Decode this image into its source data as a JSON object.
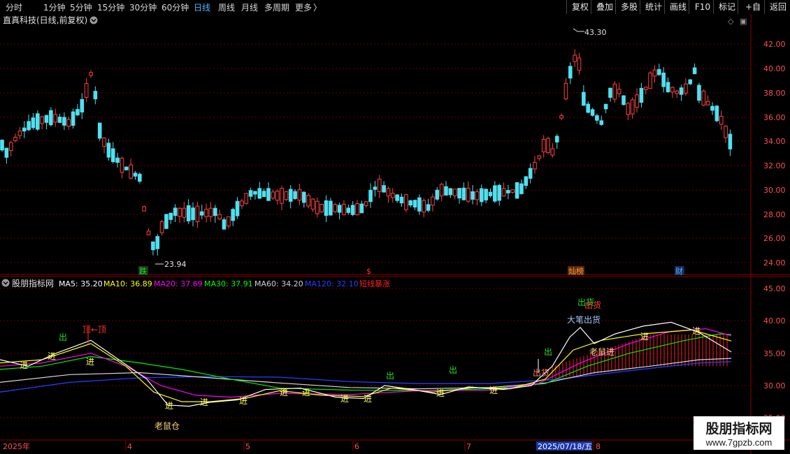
{
  "toolbar": {
    "periods": [
      "分时",
      "1分钟",
      "5分钟",
      "15分钟",
      "30分钟",
      "60分钟",
      "日线",
      "周线",
      "月线",
      "多周期",
      "更多"
    ],
    "active_period": "日线",
    "more_arrow": "〉",
    "right_buttons": [
      "复权",
      "叠加",
      "多股",
      "统计",
      "画线",
      "F10",
      "标记",
      "+自选",
      "返回"
    ]
  },
  "main_chart": {
    "title": "直真科技(日线,前复权)",
    "menu_icon": "chevron-circle-icon",
    "diamond_icon": "◇",
    "square_icon": "▣",
    "price_axis": [
      "42.00",
      "40.00",
      "38.00",
      "36.00",
      "34.00",
      "32.00",
      "30.00",
      "28.00",
      "26.00",
      "24.00"
    ],
    "high_label": "43.30",
    "low_label": "23.94",
    "event_markers": [
      {
        "text": "跌",
        "color": "#22dd22"
      },
      {
        "text": "$",
        "color": "#ff3030"
      },
      {
        "text": "灿榜",
        "color": "#ff8040"
      },
      {
        "text": "财",
        "color": "#4ab4ff"
      }
    ]
  },
  "indicator": {
    "name": "股朋指标网",
    "legend": [
      {
        "label": "MA5: 35.20",
        "color": "#ffffff"
      },
      {
        "label": "MA10: 36.89",
        "color": "#ffff00"
      },
      {
        "label": "MA20: 37.69",
        "color": "#ff00ff"
      },
      {
        "label": "MA30: 37.91",
        "color": "#00ff00"
      },
      {
        "label": "MA60: 34.20",
        "color": "#d0d0d0"
      },
      {
        "label": "MA120: 32.10",
        "color": "#2040ff"
      },
      {
        "label": "短线暴涨",
        "color": "#ff2020"
      }
    ],
    "axis": [
      "45.00",
      "40.00",
      "35.00",
      "30.00",
      "25.00"
    ],
    "annotations": [
      {
        "text": "出",
        "color": "#22dd22"
      },
      {
        "text": "顶←顶",
        "color": "#ff3030"
      },
      {
        "text": "进",
        "color": "#ffff60"
      },
      {
        "text": "老鼠仓",
        "color": "#ffd080"
      },
      {
        "text": "出",
        "color": "#22dd22"
      },
      {
        "text": "出",
        "color": "#22dd22"
      },
      {
        "text": "出货",
        "color": "#22dd22"
      },
      {
        "text": "出货",
        "color": "#ff3030"
      },
      {
        "text": "大笔出货",
        "color": "#a0c8ff"
      },
      {
        "text": "老鼠进",
        "color": "#ffd080"
      },
      {
        "text": "出",
        "color": "#22dd22"
      }
    ]
  },
  "date_axis": {
    "labels": [
      "2025年",
      "4",
      "5",
      "6",
      "7",
      "8"
    ],
    "highlight": "2025/07/18/五"
  },
  "watermark": {
    "title": "股朋指标网",
    "url": "www.7gpzb.com"
  },
  "colors": {
    "up": "#ff4040",
    "down": "#50e0f0",
    "grid": "#7a0000",
    "axis_text": "#ff5050"
  }
}
